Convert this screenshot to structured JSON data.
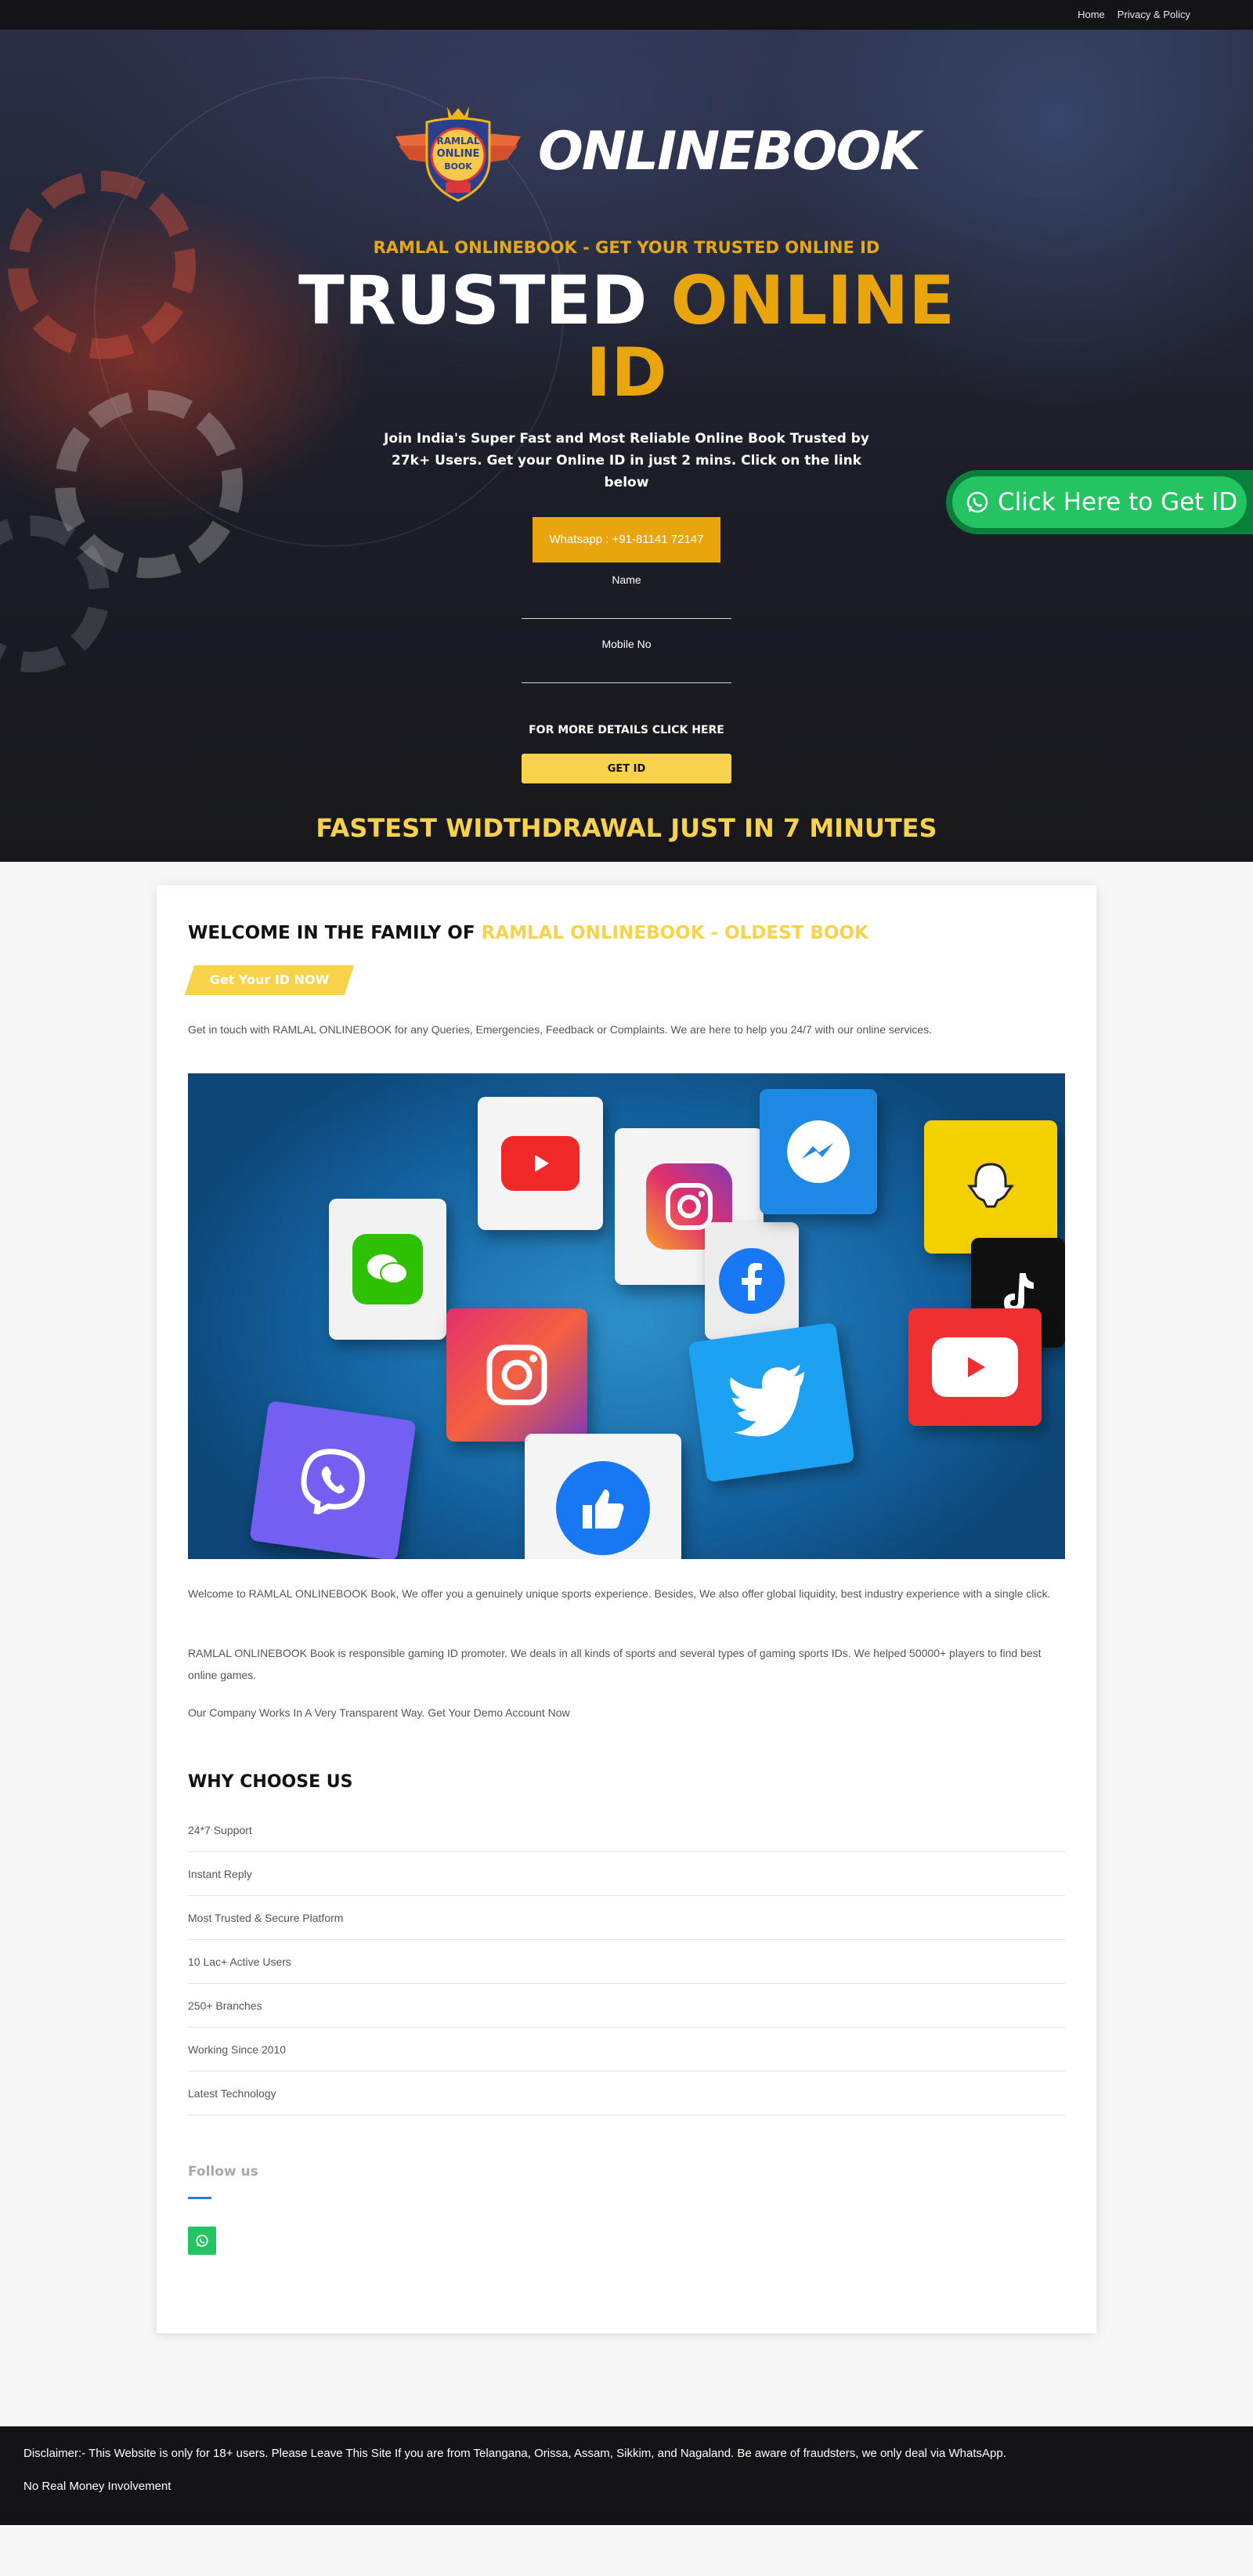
{
  "nav": {
    "home": "Home",
    "privacy": "Privacy & Policy"
  },
  "brand": {
    "emblem_line1": "RAMLAL",
    "emblem_line2": "ONLINE",
    "emblem_line3": "BOOK",
    "wordmark": "ONLINEBOOK"
  },
  "hero": {
    "tagline": "RAMLAL ONLINEBOOK - GET YOUR TRUSTED ONLINE ID",
    "headline_white": "TRUSTED",
    "headline_yellow": "ONLINE ID",
    "subtitle": "Join India's Super Fast and Most Reliable Online Book Trusted by 27k+ Users. Get your Online ID in just 2 mins. Click on the link below",
    "whatsapp_label": "Whatsapp : +91-81141 72147",
    "name_label": "Name",
    "mobile_label": "Mobile No",
    "more_details": "FOR MORE DETAILS CLICK HERE",
    "get_id_button": "GET ID",
    "fastest": "FASTEST WIDTHDRAWAL JUST IN 7 MINUTES"
  },
  "floating_button": {
    "label": "Click Here to Get ID",
    "icon": "whatsapp-icon"
  },
  "main": {
    "welcome_prefix": "WELCOME IN THE FAMILY OF",
    "welcome_highlight": "RAMLAL ONLINEBOOK - OLDEST BOOK",
    "get_id_now": "Get Your ID NOW",
    "contact_text": "Get in touch with RAMLAL ONLINEBOOK for any Queries, Emergencies, Feedback or Complaints. We are here to help you 24/7 with our online services.",
    "para1": "Welcome to RAMLAL ONLINEBOOK Book, We offer you a genuinely unique sports experience. Besides, We also offer global liquidity, best industry experience with a single click.",
    "para2": "RAMLAL ONLINEBOOK Book is responsible gaming ID promoter. We deals in all kinds of sports and several types of gaming sports IDs. We helped 50000+ players to find best online games.",
    "para3": "Our Company Works In A Very Transparent Way. Get Your Demo Account Now",
    "why_title": "WHY CHOOSE US",
    "why_items": [
      "24*7 Support",
      "Instant Reply",
      "Most Trusted & Secure Platform",
      "10 Lac+ Active Users",
      "250+ Branches",
      "Working Since 2010",
      "Latest Technology"
    ],
    "follow_us": "Follow us"
  },
  "footer": {
    "disclaimer": "Disclaimer:- This Website is only for 18+ users. Please Leave This Site If you are from Telangana, Orissa, Assam, Sikkim, and Nagaland. Be aware of fraudsters, we only deal via WhatsApp.",
    "no_money": "No Real Money Involvement"
  },
  "colors": {
    "accent_yellow": "#f8d24a",
    "accent_gold": "#e8a50e",
    "whatsapp_green": "#25c463",
    "dark": "#141418"
  }
}
